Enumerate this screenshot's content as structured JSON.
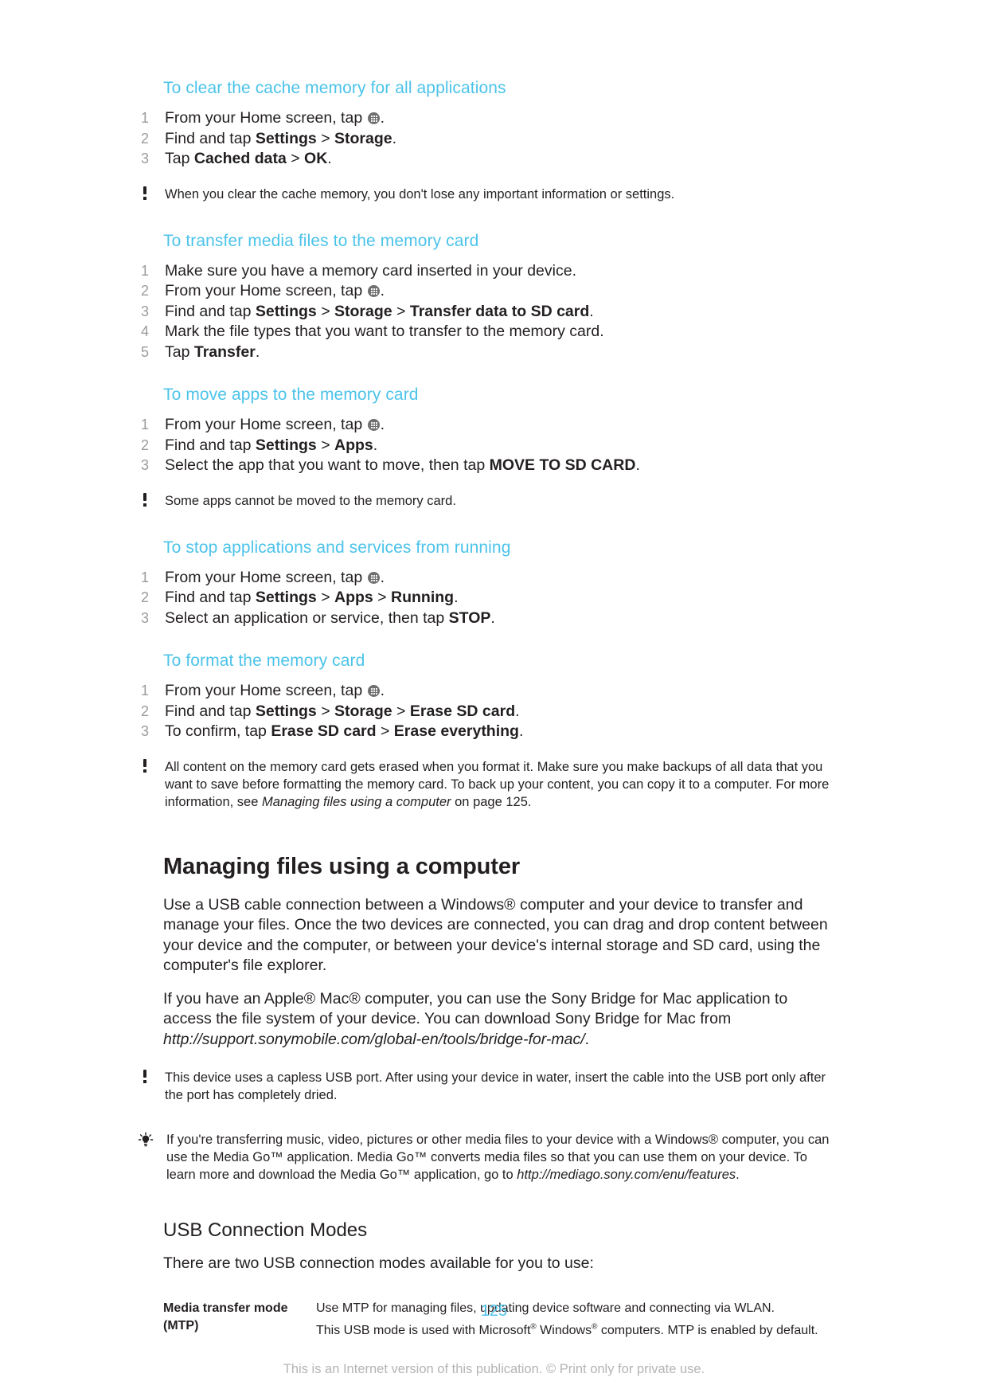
{
  "document": {
    "page_number": "125",
    "footer_text": "This is an Internet version of this publication. © Print only for private use."
  },
  "colors": {
    "heading_cyan": "#4cc3ea",
    "body_text": "#231f20",
    "step_number": "#9b9b9b",
    "footer_grey": "#b4b4b4"
  },
  "procedures": [
    {
      "title": "To clear the cache memory for all applications",
      "steps": [
        {
          "num": "1",
          "parts": [
            {
              "t": "From your Home screen, tap ",
              "s": "n"
            },
            {
              "t": "drawer-icon",
              "s": "icon"
            },
            {
              "t": ".",
              "s": "n"
            }
          ]
        },
        {
          "num": "2",
          "parts": [
            {
              "t": "Find and tap ",
              "s": "n"
            },
            {
              "t": "Settings",
              "s": "b"
            },
            {
              "t": " > ",
              "s": "n"
            },
            {
              "t": "Storage",
              "s": "b"
            },
            {
              "t": ".",
              "s": "n"
            }
          ]
        },
        {
          "num": "3",
          "parts": [
            {
              "t": "Tap ",
              "s": "n"
            },
            {
              "t": "Cached data",
              "s": "b"
            },
            {
              "t": " > ",
              "s": "n"
            },
            {
              "t": "OK",
              "s": "b"
            },
            {
              "t": ".",
              "s": "n"
            }
          ]
        }
      ],
      "note": {
        "icon": "exclamation-icon",
        "text": "When you clear the cache memory, you don't lose any important information or settings."
      }
    },
    {
      "title": "To transfer media files to the memory card",
      "steps": [
        {
          "num": "1",
          "parts": [
            {
              "t": "Make sure you have a memory card inserted in your device.",
              "s": "n"
            }
          ]
        },
        {
          "num": "2",
          "parts": [
            {
              "t": "From your Home screen, tap ",
              "s": "n"
            },
            {
              "t": "drawer-icon",
              "s": "icon"
            },
            {
              "t": ".",
              "s": "n"
            }
          ]
        },
        {
          "num": "3",
          "parts": [
            {
              "t": "Find and tap ",
              "s": "n"
            },
            {
              "t": "Settings",
              "s": "b"
            },
            {
              "t": " > ",
              "s": "n"
            },
            {
              "t": "Storage",
              "s": "b"
            },
            {
              "t": " > ",
              "s": "n"
            },
            {
              "t": "Transfer data to SD card",
              "s": "b"
            },
            {
              "t": ".",
              "s": "n"
            }
          ]
        },
        {
          "num": "4",
          "parts": [
            {
              "t": "Mark the file types that you want to transfer to the memory card.",
              "s": "n"
            }
          ]
        },
        {
          "num": "5",
          "parts": [
            {
              "t": "Tap ",
              "s": "n"
            },
            {
              "t": "Transfer",
              "s": "b"
            },
            {
              "t": ".",
              "s": "n"
            }
          ]
        }
      ],
      "note": null
    },
    {
      "title": "To move apps to the memory card",
      "steps": [
        {
          "num": "1",
          "parts": [
            {
              "t": "From your Home screen, tap ",
              "s": "n"
            },
            {
              "t": "drawer-icon",
              "s": "icon"
            },
            {
              "t": ".",
              "s": "n"
            }
          ]
        },
        {
          "num": "2",
          "parts": [
            {
              "t": "Find and tap ",
              "s": "n"
            },
            {
              "t": "Settings",
              "s": "b"
            },
            {
              "t": " > ",
              "s": "n"
            },
            {
              "t": "Apps",
              "s": "b"
            },
            {
              "t": ".",
              "s": "n"
            }
          ]
        },
        {
          "num": "3",
          "parts": [
            {
              "t": "Select the app that you want to move, then tap ",
              "s": "n"
            },
            {
              "t": "MOVE TO SD CARD",
              "s": "b"
            },
            {
              "t": ".",
              "s": "n"
            }
          ]
        }
      ],
      "note": {
        "icon": "exclamation-icon",
        "text": "Some apps cannot be moved to the memory card."
      }
    },
    {
      "title": "To stop applications and services from running",
      "steps": [
        {
          "num": "1",
          "parts": [
            {
              "t": "From your Home screen, tap ",
              "s": "n"
            },
            {
              "t": "drawer-icon",
              "s": "icon"
            },
            {
              "t": ".",
              "s": "n"
            }
          ]
        },
        {
          "num": "2",
          "parts": [
            {
              "t": "Find and tap ",
              "s": "n"
            },
            {
              "t": "Settings",
              "s": "b"
            },
            {
              "t": " > ",
              "s": "n"
            },
            {
              "t": "Apps",
              "s": "b"
            },
            {
              "t": " > ",
              "s": "n"
            },
            {
              "t": "Running",
              "s": "b"
            },
            {
              "t": ".",
              "s": "n"
            }
          ]
        },
        {
          "num": "3",
          "parts": [
            {
              "t": "Select an application or service, then tap ",
              "s": "n"
            },
            {
              "t": "STOP",
              "s": "b"
            },
            {
              "t": ".",
              "s": "n"
            }
          ]
        }
      ],
      "note": null
    },
    {
      "title": "To format the memory card",
      "steps": [
        {
          "num": "1",
          "parts": [
            {
              "t": "From your Home screen, tap ",
              "s": "n"
            },
            {
              "t": "drawer-icon",
              "s": "icon"
            },
            {
              "t": ".",
              "s": "n"
            }
          ]
        },
        {
          "num": "2",
          "parts": [
            {
              "t": "Find and tap ",
              "s": "n"
            },
            {
              "t": "Settings",
              "s": "b"
            },
            {
              "t": " > ",
              "s": "n"
            },
            {
              "t": "Storage",
              "s": "b"
            },
            {
              "t": " > ",
              "s": "n"
            },
            {
              "t": "Erase SD card",
              "s": "b"
            },
            {
              "t": ".",
              "s": "n"
            }
          ]
        },
        {
          "num": "3",
          "parts": [
            {
              "t": "To confirm, tap ",
              "s": "n"
            },
            {
              "t": "Erase SD card",
              "s": "b"
            },
            {
              "t": " > ",
              "s": "n"
            },
            {
              "t": "Erase everything",
              "s": "b"
            },
            {
              "t": ".",
              "s": "n"
            }
          ]
        }
      ],
      "note": {
        "icon": "exclamation-icon",
        "parts": [
          {
            "t": "All content on the memory card gets erased when you format it. Make sure you make backups of all data that you want to save before formatting the memory card. To back up your content, you can copy it to a computer. For more information, see ",
            "s": "n"
          },
          {
            "t": "Managing files using a computer",
            "s": "i"
          },
          {
            "t": " on page 125.",
            "s": "n"
          }
        ]
      }
    }
  ],
  "section": {
    "heading": "Managing files using a computer",
    "paragraphs": [
      {
        "parts": [
          {
            "t": "Use a USB cable connection between a Windows® computer and your device to transfer and manage your files. Once the two devices are connected, you can drag and drop content between your device and the computer, or between your device's internal storage and SD card, using the computer's file explorer.",
            "s": "n"
          }
        ]
      },
      {
        "parts": [
          {
            "t": "If you have an Apple® Mac® computer, you can use the Sony Bridge for Mac application to access the file system of your device. You can download Sony Bridge for Mac from ",
            "s": "n"
          },
          {
            "t": "http://support.sonymobile.com/global-en/tools/bridge-for-mac/",
            "s": "i"
          },
          {
            "t": ".",
            "s": "n"
          }
        ]
      }
    ],
    "warning": {
      "icon": "exclamation-icon",
      "text": "This device uses a capless USB port. After using your device in water, insert the cable into the USB port only after the port has completely dried."
    },
    "tip": {
      "icon": "lightbulb-icon",
      "parts": [
        {
          "t": "If you're transferring music, video, pictures or other media files to your device with a Windows® computer, you can use the Media Go™ application. Media Go™ converts media files so that you can use them on your device. To learn more and download the Media Go™ application, go to ",
          "s": "n"
        },
        {
          "t": "http://mediago.sony.com/enu/features",
          "s": "i"
        },
        {
          "t": ".",
          "s": "n"
        }
      ]
    }
  },
  "usb_modes": {
    "heading": "USB Connection Modes",
    "intro": "There are two USB connection modes available for you to use:",
    "rows": [
      {
        "term": "Media transfer mode (MTP)",
        "definition_lines": [
          [
            {
              "t": "Use MTP for managing files, updating device software and connecting via WLAN.",
              "s": "n"
            }
          ],
          [
            {
              "t": "This USB mode is used with Microsoft",
              "s": "n"
            },
            {
              "t": "®",
              "s": "sup"
            },
            {
              "t": " Windows",
              "s": "n"
            },
            {
              "t": "®",
              "s": "sup"
            },
            {
              "t": " computers. MTP is enabled by default.",
              "s": "n"
            }
          ]
        ]
      }
    ]
  }
}
